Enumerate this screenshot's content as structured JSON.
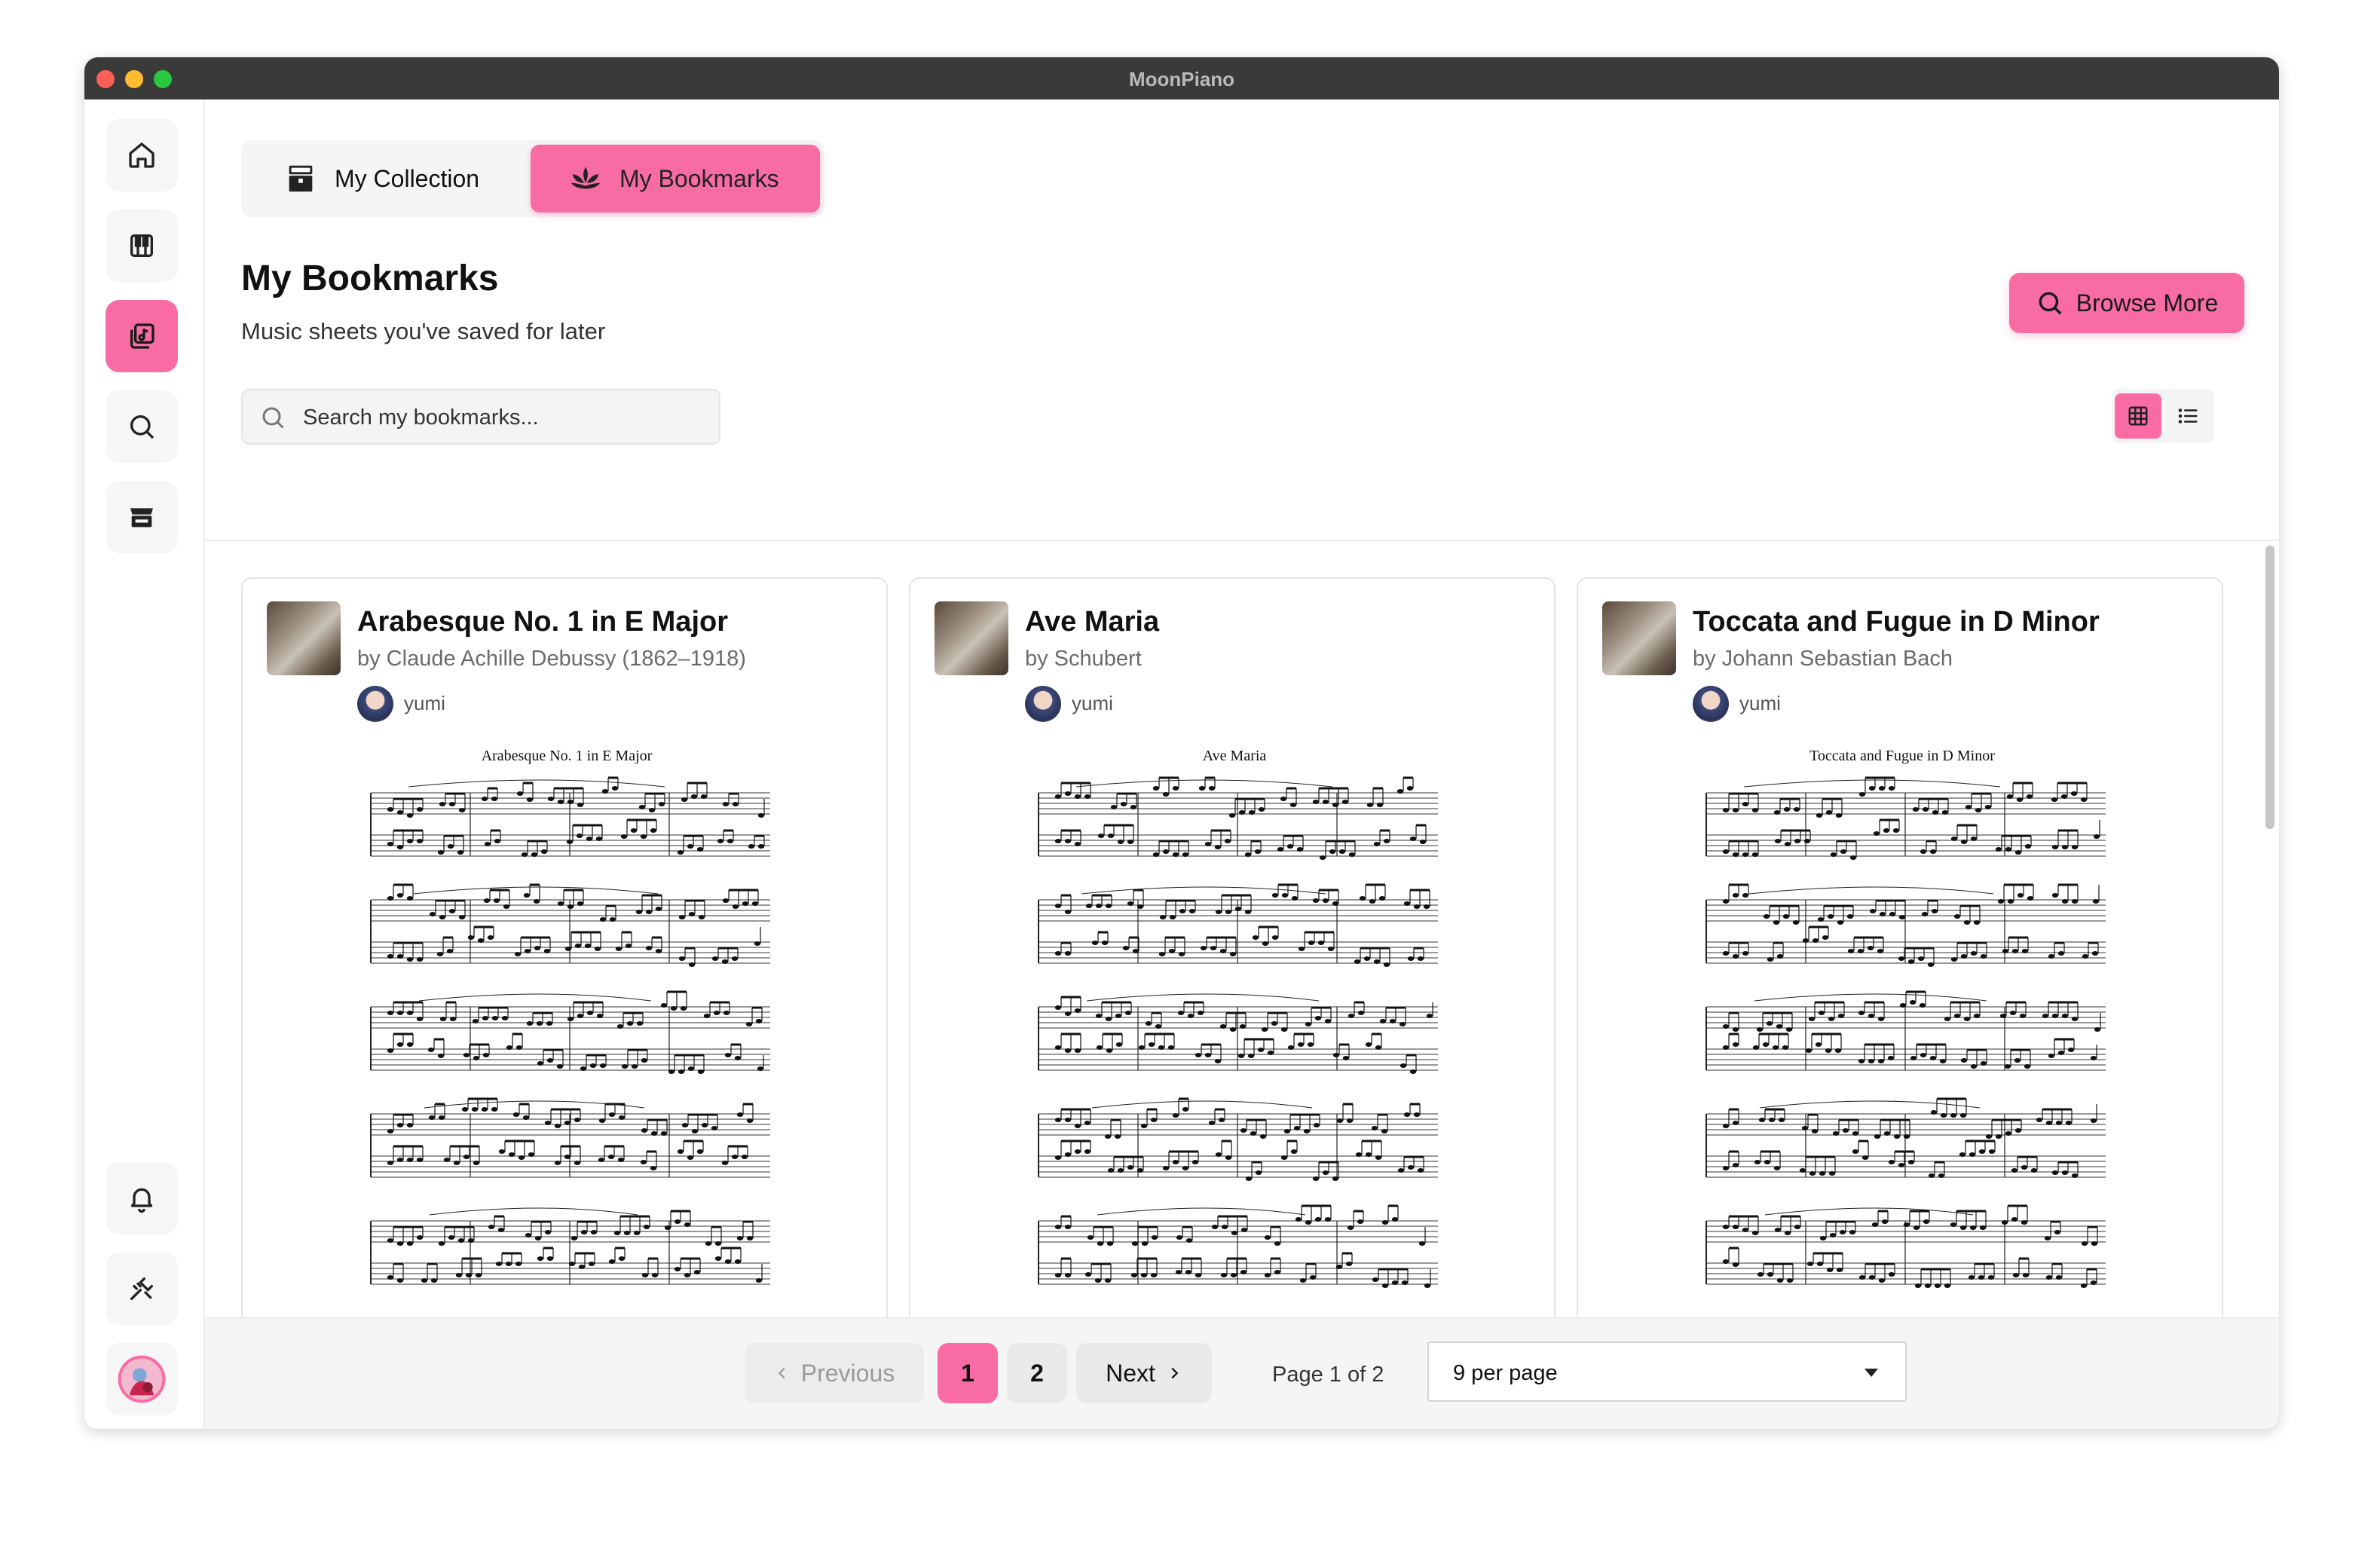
{
  "window": {
    "title": "MoonPiano"
  },
  "sidebar": {
    "items": [
      {
        "icon": "home-icon"
      },
      {
        "icon": "piano-icon"
      },
      {
        "icon": "library-icon",
        "active": true
      },
      {
        "icon": "search-icon"
      },
      {
        "icon": "store-icon"
      },
      {
        "icon": "bell-icon"
      },
      {
        "icon": "tools-icon"
      },
      {
        "icon": "avatar"
      }
    ]
  },
  "tabs": [
    {
      "label": "My Collection",
      "icon": "chest-icon"
    },
    {
      "label": "My Bookmarks",
      "icon": "lotus-icon",
      "active": true
    }
  ],
  "header": {
    "title": "My Bookmarks",
    "subtitle": "Music sheets you've saved for later",
    "browse_label": "Browse More"
  },
  "search": {
    "placeholder": "Search my bookmarks..."
  },
  "view": {
    "mode": "grid"
  },
  "colors": {
    "accent": "#f86ca3"
  },
  "cards": [
    {
      "title": "Arabesque No. 1 in E Major",
      "composer": "by Claude Achille Debussy (1862–1918)",
      "user": "yumi",
      "sheet_title": "Arabesque No. 1 in E Major"
    },
    {
      "title": "Ave Maria",
      "composer": "by Schubert",
      "user": "yumi",
      "sheet_title": "Ave Maria"
    },
    {
      "title": "Toccata and Fugue in D Minor",
      "composer": "by Johann Sebastian Bach",
      "user": "yumi",
      "sheet_title": "Toccata and Fugue in D Minor"
    }
  ],
  "pagination": {
    "previous_label": "Previous",
    "pages": [
      "1",
      "2"
    ],
    "current": "1",
    "next_label": "Next",
    "page_info": "Page 1 of 2",
    "per_page": "9 per page"
  }
}
